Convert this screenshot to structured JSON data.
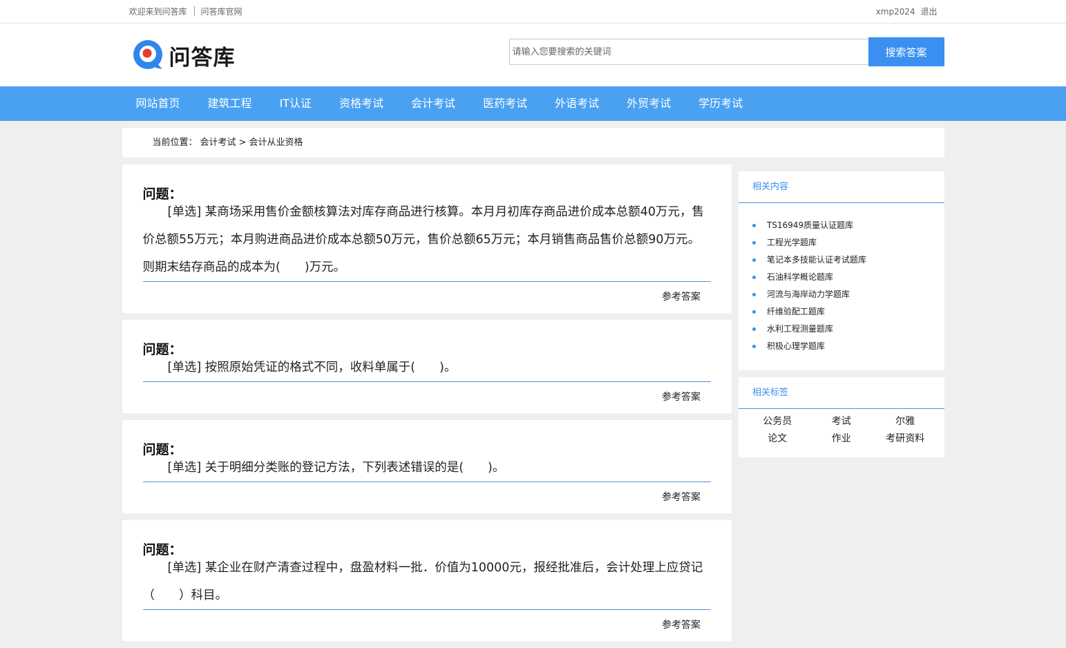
{
  "topbar": {
    "welcome": "欢迎来到问答库",
    "official_site": "问答库官网",
    "username": "xmp2024",
    "logout": "退出"
  },
  "header": {
    "logo_text": "问答库",
    "search_placeholder": "请输入您要搜索的关键词",
    "search_button": "搜索答案"
  },
  "nav": {
    "items": [
      "网站首页",
      "建筑工程",
      "IT认证",
      "资格考试",
      "会计考试",
      "医药考试",
      "外语考试",
      "外贸考试",
      "学历考试"
    ]
  },
  "breadcrumb": {
    "prefix": "当前位置：",
    "level1": "会计考试",
    "separator": ">",
    "level2": "会计从业资格"
  },
  "questions": [
    {
      "title": "问题：",
      "text": "[单选] 某商场采用售价金额核算法对库存商品进行核算。本月月初库存商品进价成本总额40万元，售价总额55万元；本月购进商品进价成本总额50万元，售价总额65万元；本月销售商品售价总额90万元。则期末结存商品的成本为(　　)万元。",
      "answer_link": "参考答案"
    },
    {
      "title": "问题：",
      "text": "[单选] 按照原始凭证的格式不同，收料单属于(　　)。",
      "answer_link": "参考答案"
    },
    {
      "title": "问题：",
      "text": "[单选] 关于明细分类账的登记方法，下列表述错误的是(　　)。",
      "answer_link": "参考答案"
    },
    {
      "title": "问题：",
      "text": "[单选] 某企业在财产清查过程中，盘盈材料一批．价值为10000元，报经批准后，会计处理上应贷记（　　）科目。",
      "answer_link": "参考答案"
    }
  ],
  "sidebar": {
    "related_title": "相关内容",
    "related_items": [
      "TS16949质量认证题库",
      "工程光学题库",
      "笔记本多技能认证考试题库",
      "石油科学概论题库",
      "河流与海岸动力学题库",
      "纤维验配工题库",
      "水利工程测量题库",
      "积极心理学题库"
    ],
    "tags_title": "相关标签",
    "tags": [
      "公务员",
      "考试",
      "尔雅",
      "论文",
      "作业",
      "考研资料"
    ]
  },
  "colors": {
    "nav_bg": "#4aa1f2",
    "accent": "#3a8ff0",
    "page_bg": "#efefef"
  }
}
